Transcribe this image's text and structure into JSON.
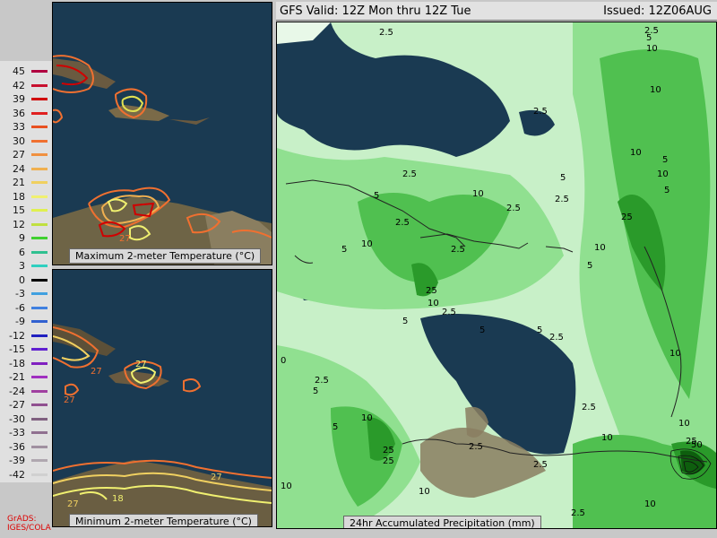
{
  "header": {
    "valid": "GFS Valid: 12Z Mon thru 12Z Tue",
    "issued": "Issued: 12Z06AUG"
  },
  "legend": {
    "values": [
      "45",
      "42",
      "39",
      "36",
      "33",
      "30",
      "27",
      "24",
      "21",
      "18",
      "15",
      "12",
      "9",
      "6",
      "3",
      "0",
      "-3",
      "-6",
      "-9",
      "-12",
      "-15",
      "-18",
      "-21",
      "-24",
      "-27",
      "-30",
      "-33",
      "-36",
      "-39",
      "-42"
    ],
    "colors": [
      "#b00040",
      "#c8102e",
      "#d00000",
      "#e02020",
      "#e85020",
      "#f07030",
      "#f09040",
      "#f0b050",
      "#f0d060",
      "#f0f070",
      "#e0f050",
      "#c0e040",
      "#40d030",
      "#30c090",
      "#30d0c0",
      "#000000",
      "#40a0e0",
      "#4080e0",
      "#3060d0",
      "#2020c0",
      "#6020d0",
      "#8020c0",
      "#a030c0",
      "#a040a0",
      "#905090",
      "#806080",
      "#907090",
      "#a090a0",
      "#b0a8b0",
      "#d0d0d0"
    ]
  },
  "panels": {
    "max_title": "Maximum 2-meter Temperature (°C)",
    "min_title": "Minimum 2-meter Temperature (°C)",
    "precip_title": "24hr Accumulated Precipitation (mm)",
    "max_labels": [
      "27"
    ],
    "min_labels": [
      "27",
      "27",
      "27",
      "18",
      "27",
      "27"
    ]
  },
  "precip_labels": {
    "l_2_5": "2.5",
    "l_5": "5",
    "l_10": "10",
    "l_25": "25",
    "l_50": "50",
    "l_0": "0"
  },
  "footer": {
    "grads": "GrADS:",
    "iges": "IGES/COLA"
  }
}
